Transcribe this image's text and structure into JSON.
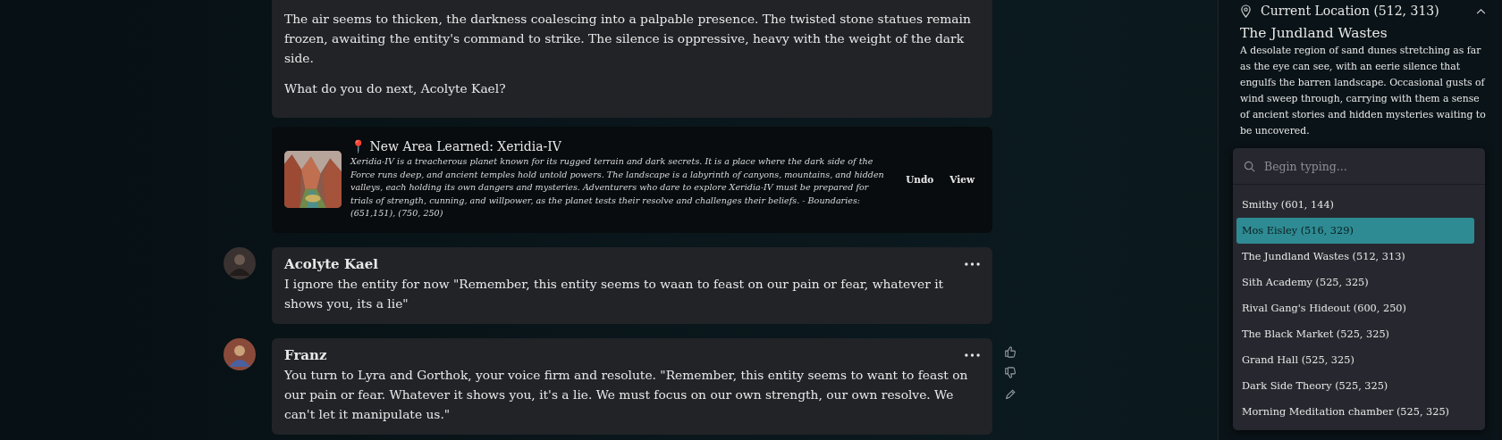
{
  "narration": {
    "paragraphs": [
      "The air seems to thicken, the darkness coalescing into a palpable presence. The twisted stone statues remain frozen, awaiting the entity's command to strike. The silence is oppressive, heavy with the weight of the dark side.",
      "What do you do next, Acolyte Kael?"
    ]
  },
  "area_notice": {
    "pin": "📍",
    "title": "New Area Learned: Xeridia-IV",
    "description": "Xeridia-IV is a treacherous planet known for its rugged terrain and dark secrets. It is a place where the dark side of the Force runs deep, and ancient temples hold untold powers. The landscape is a labyrinth of canyons, mountains, and hidden valleys, each holding its own dangers and mysteries. Adventurers who dare to explore Xeridia-IV must be prepared for trials of strength, cunning, and willpower, as the planet tests their resolve and challenges their beliefs. - Boundaries: (651,151), (750, 250)",
    "actions": [
      "Undo",
      "View"
    ]
  },
  "messages": [
    {
      "kind": "player",
      "author": "Acolyte Kael",
      "text": " I ignore the entity for now \"Remember, this entity seems to waan to feast on our pain or fear, whatever it shows you, its a lie\""
    },
    {
      "kind": "narrator",
      "author": "Franz",
      "text": "You turn to Lyra and Gorthok, your voice firm and resolute. \"Remember, this entity seems to want to feast on our pain or fear. Whatever it shows you, it's a lie. We must focus on our own strength, our own resolve. We can't let it manipulate us.\""
    }
  ],
  "location_panel": {
    "header": "Current Location (512, 313)",
    "expanded": true,
    "name": "The Jundland Wastes",
    "description": "A desolate region of sand dunes stretching as far as the eye can see, with an eerie silence that engulfs the barren landscape. Occasional gusts of wind sweep through, carrying with them a sense of ancient stories and hidden mysteries waiting to be uncovered."
  },
  "location_picker": {
    "placeholder": "Begin typing...",
    "options": [
      {
        "label": "Smithy (601, 144)",
        "selected": false
      },
      {
        "label": "Mos Eisley (516, 329)",
        "selected": true
      },
      {
        "label": "The Jundland Wastes (512, 313)",
        "selected": false
      },
      {
        "label": "Sith Academy (525, 325)",
        "selected": false
      },
      {
        "label": "Rival Gang's Hideout (600, 250)",
        "selected": false
      },
      {
        "label": "The Black Market (525, 325)",
        "selected": false
      },
      {
        "label": "Grand Hall (525, 325)",
        "selected": false
      },
      {
        "label": "Dark Side Theory (525, 325)",
        "selected": false
      },
      {
        "label": "Morning Meditation chamber (525, 325)",
        "selected": false
      }
    ]
  }
}
